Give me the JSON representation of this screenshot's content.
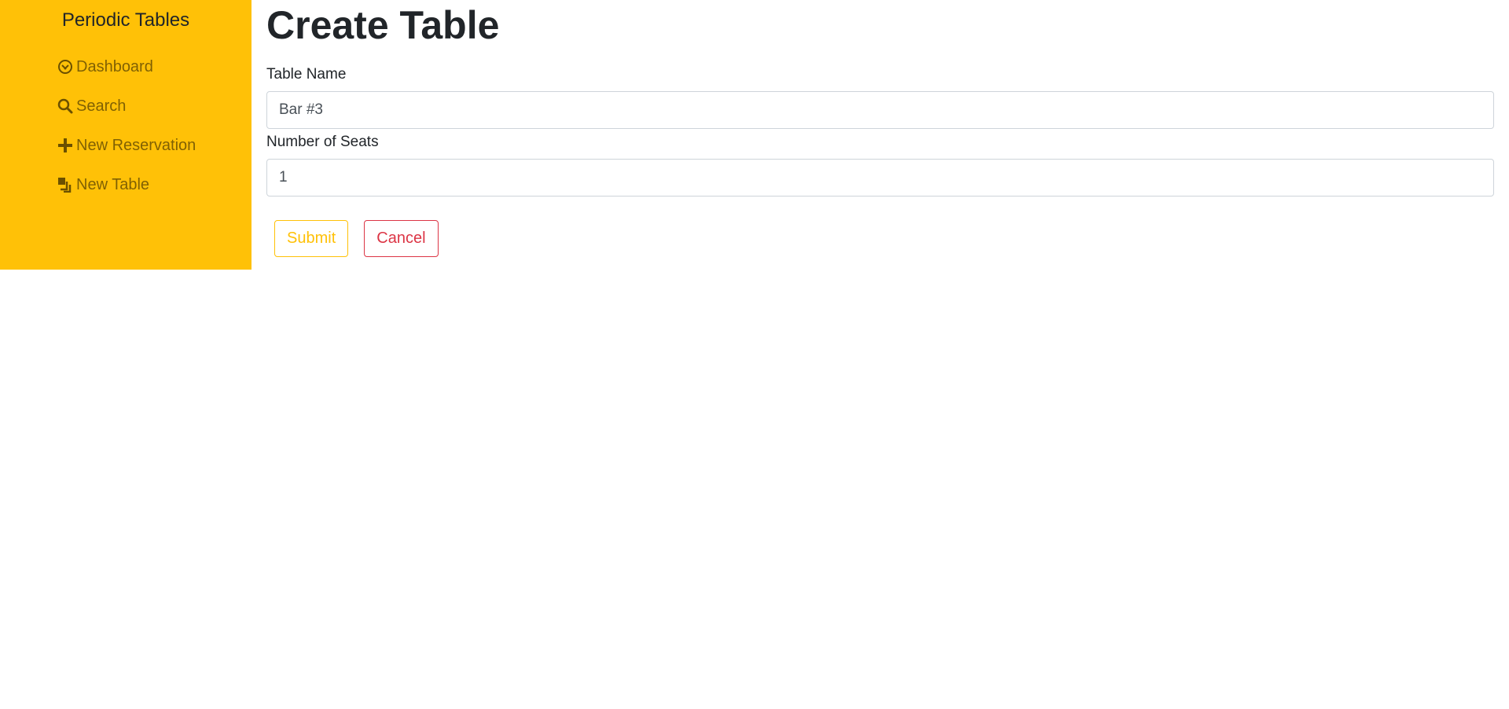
{
  "sidebar": {
    "brand": "Periodic Tables",
    "items": [
      {
        "label": "Dashboard",
        "icon": "dashboard-icon"
      },
      {
        "label": "Search",
        "icon": "search-icon"
      },
      {
        "label": "New Reservation",
        "icon": "plus-icon"
      },
      {
        "label": "New Table",
        "icon": "layers-icon"
      }
    ]
  },
  "main": {
    "title": "Create Table",
    "form": {
      "table_name_label": "Table Name",
      "table_name_value": "Bar #3",
      "seats_label": "Number of Seats",
      "seats_value": "1"
    },
    "actions": {
      "submit_label": "Submit",
      "cancel_label": "Cancel"
    }
  },
  "colors": {
    "sidebar_bg": "#ffc107",
    "submit": "#ffc107",
    "cancel": "#dc3545"
  }
}
